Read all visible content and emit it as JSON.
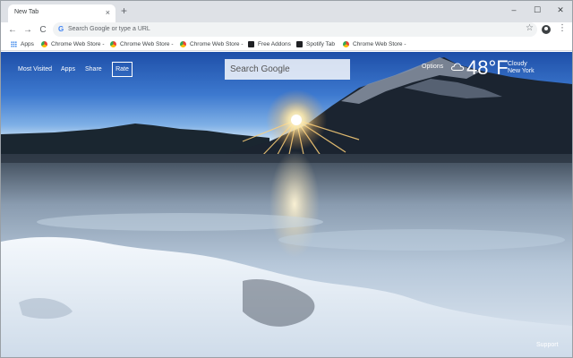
{
  "browser": {
    "tab_title": "New Tab",
    "tab_close": "×",
    "new_tab": "+",
    "win_min": "–",
    "win_max": "☐",
    "win_close": "✕",
    "back": "←",
    "forward": "→",
    "reload": "C",
    "g_letter": "G",
    "omnibox_placeholder": "Search Google or type a URL",
    "star": "☆",
    "menu": "⋮"
  },
  "bookmarks": [
    {
      "label": "Apps",
      "icon": "apps-grid-icon"
    },
    {
      "label": "Chrome Web Store -",
      "icon": "chrome-web-store-icon"
    },
    {
      "label": "Chrome Web Store -",
      "icon": "chrome-web-store-icon"
    },
    {
      "label": "Chrome Web Store -",
      "icon": "chrome-web-store-icon"
    },
    {
      "label": "Free Addons",
      "icon": "free-addons-icon"
    },
    {
      "label": "Spotify Tab",
      "icon": "spotify-tab-icon"
    },
    {
      "label": "Chrome Web Store -",
      "icon": "chrome-web-store-icon"
    }
  ],
  "newtab": {
    "links": [
      "Most Visited",
      "Apps",
      "Share"
    ],
    "rate": "Rate",
    "search_placeholder": "Search Google",
    "options": "Options",
    "weather": {
      "temp": "48°F",
      "condition": "Cloudy",
      "location": "New York",
      "icon": "cloud-icon"
    },
    "support": "Support"
  },
  "colors": {
    "tabstrip": "#dee1e6",
    "sky_top": "#1e4fa8",
    "text_on_image": "#ffffff"
  }
}
